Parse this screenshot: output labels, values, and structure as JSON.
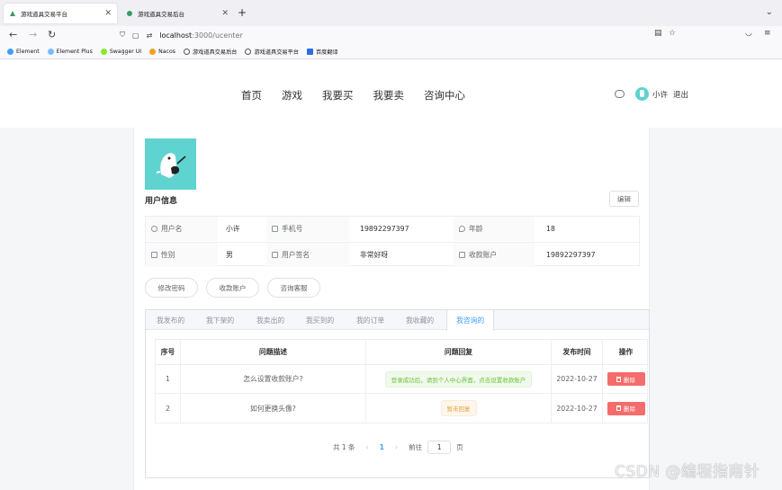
{
  "browser": {
    "tabs": [
      {
        "title": "游戏道具交易平台",
        "active": true
      },
      {
        "title": "游戏道具交易后台",
        "active": false
      }
    ],
    "url_host": "localhost",
    "url_path": ":3000/ucenter",
    "bookmarks": [
      "Element",
      "Element Plus",
      "Swagger UI",
      "Nacos",
      "游戏道具交易后台",
      "游戏道具交易平台",
      "百度翻译"
    ]
  },
  "header": {
    "menu": [
      "首页",
      "游戏",
      "我要买",
      "我要卖",
      "咨询中心"
    ],
    "username": "小许",
    "logout": "退出"
  },
  "profile": {
    "section_title": "用户信息",
    "edit_label": "编辑",
    "fields": {
      "username_label": "用户名",
      "username": "小许",
      "phone_label": "手机号",
      "phone": "19892297397",
      "age_label": "年龄",
      "age": "18",
      "gender_label": "性别",
      "gender": "男",
      "signature_label": "用户签名",
      "signature": "非常好呀",
      "account_label": "收款账户",
      "account": "19892297397"
    },
    "actions": [
      "修改密码",
      "收款账户",
      "咨询客服"
    ]
  },
  "tabs": {
    "items": [
      "我发布的",
      "我下架的",
      "我卖出的",
      "我买到的",
      "我的订单",
      "我收藏的",
      "我咨询的"
    ],
    "active_index": 6
  },
  "table": {
    "headers": [
      "序号",
      "问题描述",
      "问题回复",
      "发布时间",
      "操作"
    ],
    "rows": [
      {
        "no": "1",
        "question": "怎么设置收款账户?",
        "reply": "登录成功后，请到个人中心界面，点击设置收款账户",
        "reply_type": "success",
        "date": "2022-10-27",
        "action": "删除"
      },
      {
        "no": "2",
        "question": "如何更换头像?",
        "reply": "暂未回复",
        "reply_type": "warning",
        "date": "2022-10-27",
        "action": "删除"
      }
    ]
  },
  "pagination": {
    "total": "共 1 条",
    "current": "1",
    "goto_label": "前往",
    "goto_value": "1",
    "page_suffix": "页"
  },
  "watermark": "CSDN @编程指南针",
  "colors": {
    "primary": "#409eff",
    "danger": "#f56c6c",
    "avatar": "#5fd3d0"
  }
}
